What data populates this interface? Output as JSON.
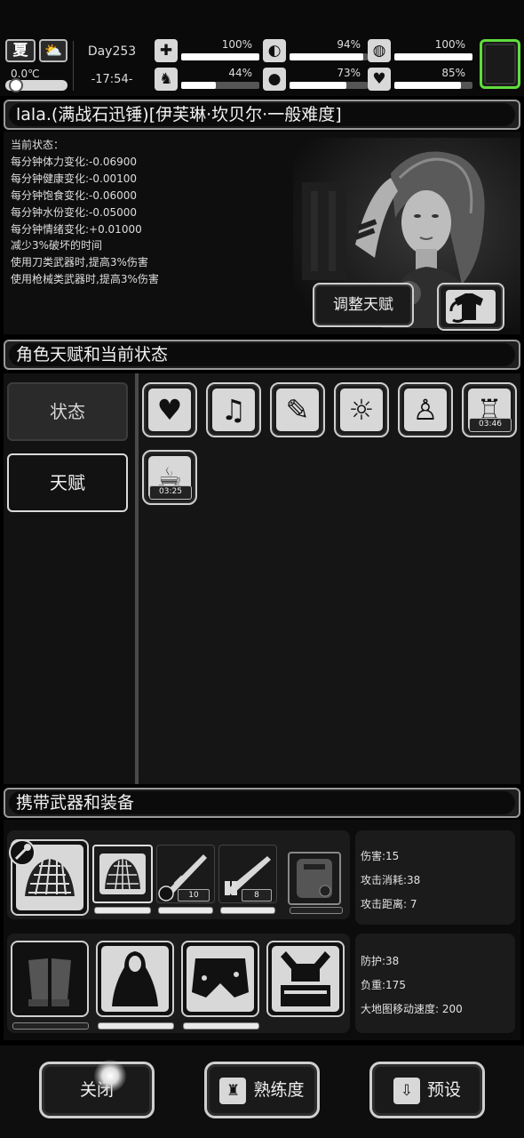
{
  "topbar": {
    "season": "夏",
    "weather_icon": "partly-cloudy-icon",
    "temperature": "0.0℃",
    "temperature_level": 0.12,
    "day": "Day253",
    "time": "-17:54-",
    "stats": [
      {
        "name": "health",
        "icon": "medkit-icon",
        "glyph": "✚",
        "percent_text": "100%",
        "value": 100
      },
      {
        "name": "food",
        "icon": "stomach-icon",
        "glyph": "◐",
        "percent_text": "94%",
        "value": 94
      },
      {
        "name": "mood",
        "icon": "pill-icon",
        "glyph": "◍",
        "percent_text": "100%",
        "value": 100
      },
      {
        "name": "stamina",
        "icon": "foot-icon",
        "glyph": "♞",
        "percent_text": "44%",
        "value": 44
      },
      {
        "name": "water",
        "icon": "water-drop-icon",
        "glyph": "●",
        "percent_text": "73%",
        "value": 73
      },
      {
        "name": "emotion",
        "icon": "heart-icon",
        "glyph": "♥",
        "percent_text": "85%",
        "value": 85
      }
    ],
    "accent_color": "#5fdc3c"
  },
  "character": {
    "title": "lala.(满战石迅锤)[伊芙琳·坎贝尔·一般难度]",
    "status_lines": [
      "当前状态：",
      "每分钟体力变化:-0.06900",
      "每分钟健康变化:-0.00100",
      "每分钟饱食变化:-0.06000",
      "每分钟水份变化:-0.05000",
      "每分钟情绪变化:+0.01000",
      "减少3%破坏的时间",
      "使用刀类武器时,提高3%伤害",
      "使用枪械类武器时,提高3%伤害"
    ],
    "adjust_talent_label": "调整天赋"
  },
  "traits": {
    "header": "角色天赋和当前状态",
    "tabs": [
      {
        "label": "状态",
        "active": true
      },
      {
        "label": "天赋",
        "active": false
      }
    ],
    "slots": [
      {
        "icon": "heart-icon",
        "glyph": "♥",
        "timer": ""
      },
      {
        "icon": "music-heart-icon",
        "glyph": "♫",
        "timer": ""
      },
      {
        "icon": "medicine-checklist-icon",
        "glyph": "✎",
        "timer": ""
      },
      {
        "icon": "alarm-light-icon",
        "glyph": "☼",
        "timer": ""
      },
      {
        "icon": "person-heartbeat-icon",
        "glyph": "♙",
        "timer": ""
      },
      {
        "icon": "clean-shirt-icon",
        "glyph": "♖",
        "timer": "03:46"
      },
      {
        "icon": "meal-plate-icon",
        "glyph": "☕",
        "timer": "03:25"
      }
    ]
  },
  "equipment": {
    "header": "携带武器和装备",
    "weapons_ammo": [
      "10",
      "8"
    ],
    "weapon_stats": [
      "伤害:15",
      "攻击消耗:38",
      "攻击距离: 7"
    ],
    "armor_stats": [
      "防护:38",
      "负重:175",
      "大地图移动速度: 200"
    ]
  },
  "bottom": {
    "close_label": "关闭",
    "proficiency_label": "熟练度",
    "preset_label": "预设"
  }
}
